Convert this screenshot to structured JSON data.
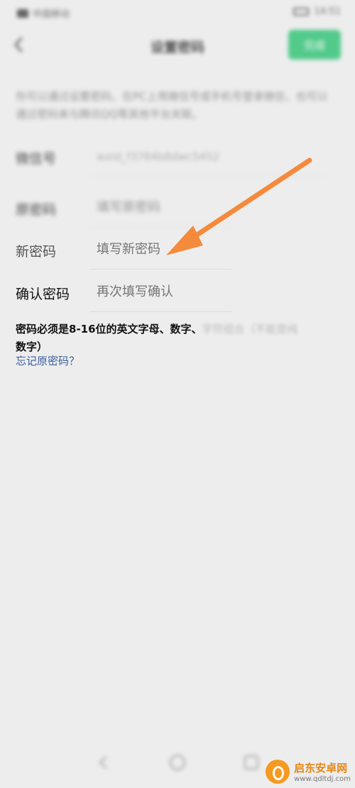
{
  "status_bar": {
    "carrier": "中国移动",
    "time": "14:51"
  },
  "header": {
    "title": "设置密码",
    "done_label": "完成"
  },
  "description": "你可以通过设置密码，在PC上用微信号或手机号登录微信，也可以通过密码来与腾讯QQ等其他平台关联。",
  "rows": {
    "account": {
      "label": "微信号",
      "value": "wxid_f3784b8dwc5452"
    },
    "old_password": {
      "label": "原密码",
      "placeholder": "填写原密码"
    },
    "new_password": {
      "label": "新密码",
      "placeholder": "填写新密码"
    },
    "confirm_password": {
      "label": "确认密码",
      "placeholder": "再次填写确认"
    }
  },
  "rule": {
    "main": "密码必须是8-16位的英文字母、数字、",
    "faded": "字符组合（不能是纯",
    "line2": "数字）"
  },
  "forgot_link": "忘记原密码？",
  "watermark": {
    "name": "启东安卓网",
    "url": "www.qdltdj.com",
    "logo_icon": "orange-circle-logo"
  },
  "colors": {
    "accent": "#1fbf6a",
    "link": "#3a5e9c",
    "arrow": "#f58a3c"
  }
}
